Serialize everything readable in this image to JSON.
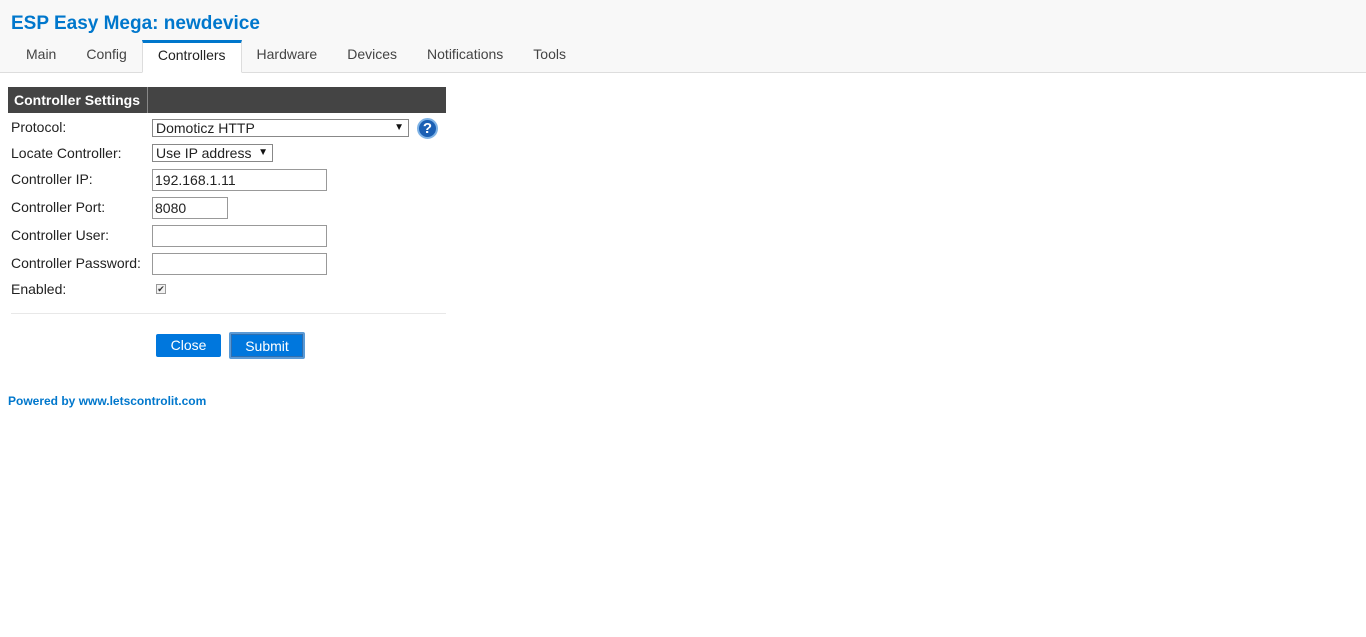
{
  "app": {
    "title": "ESP Easy Mega: newdevice"
  },
  "tabs": [
    {
      "label": "Main"
    },
    {
      "label": "Config"
    },
    {
      "label": "Controllers",
      "active": true
    },
    {
      "label": "Hardware"
    },
    {
      "label": "Devices"
    },
    {
      "label": "Notifications"
    },
    {
      "label": "Tools"
    }
  ],
  "settings": {
    "header": "Controller Settings",
    "protocol": {
      "label": "Protocol:",
      "value": "Domoticz HTTP",
      "help_icon": "help-icon"
    },
    "locate": {
      "label": "Locate Controller:",
      "value": "Use IP address"
    },
    "ip": {
      "label": "Controller IP:",
      "value": "192.168.1.11"
    },
    "port": {
      "label": "Controller Port:",
      "value": "8080"
    },
    "user": {
      "label": "Controller User:",
      "value": ""
    },
    "password": {
      "label": "Controller Password:",
      "value": ""
    },
    "enabled": {
      "label": "Enabled:",
      "checked": true
    }
  },
  "buttons": {
    "close": "Close",
    "submit": "Submit"
  },
  "footer": {
    "text": "Powered by www.letscontrolit.com"
  },
  "colors": {
    "accent": "#0077cc",
    "header_bar": "#444444",
    "button": "#0077dd"
  }
}
